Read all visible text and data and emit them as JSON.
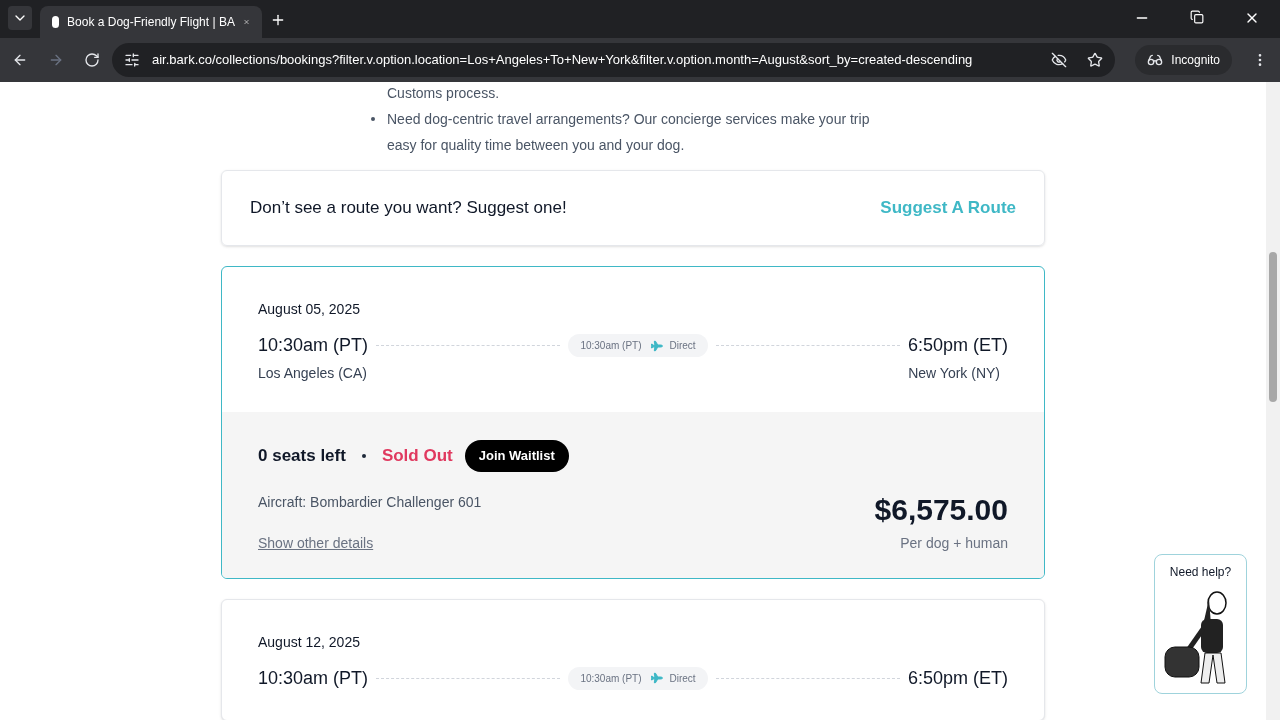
{
  "browser": {
    "tab_title": "Book a Dog-Friendly Flight | BA",
    "url": "air.bark.co/collections/bookings?filter.v.option.location=Los+Angeles+To+New+York&filter.v.option.month=August&sort_by=created-descending",
    "profile": "Incognito"
  },
  "bullets": [
    "Customs process.",
    "Need dog-centric travel arrangements? Our concierge services make your trip easy for quality time between you and your dog."
  ],
  "suggest": {
    "text": "Don’t see a route you want? Suggest one!",
    "link": "Suggest A Route"
  },
  "flights": [
    {
      "selected": true,
      "date": "August 05, 2025",
      "depart_time": "10:30am (PT)",
      "depart_city": "Los Angeles (CA)",
      "mid_time": "10:30am (PT)",
      "mid_label": "Direct",
      "arrive_time": "6:50pm (ET)",
      "arrive_city": "New York (NY)",
      "seats": "0 seats left",
      "status": "Sold Out",
      "action": "Join Waitlist",
      "aircraft": "Aircraft: Bombardier Challenger 601",
      "details_link": "Show other details",
      "price": "$6,575.00",
      "price_note": "Per dog + human"
    },
    {
      "selected": false,
      "date": "August 12, 2025",
      "depart_time": "10:30am (PT)",
      "mid_time": "10:30am (PT)",
      "mid_label": "Direct",
      "arrive_time": "6:50pm (ET)"
    }
  ],
  "help": {
    "label": "Need help?"
  }
}
